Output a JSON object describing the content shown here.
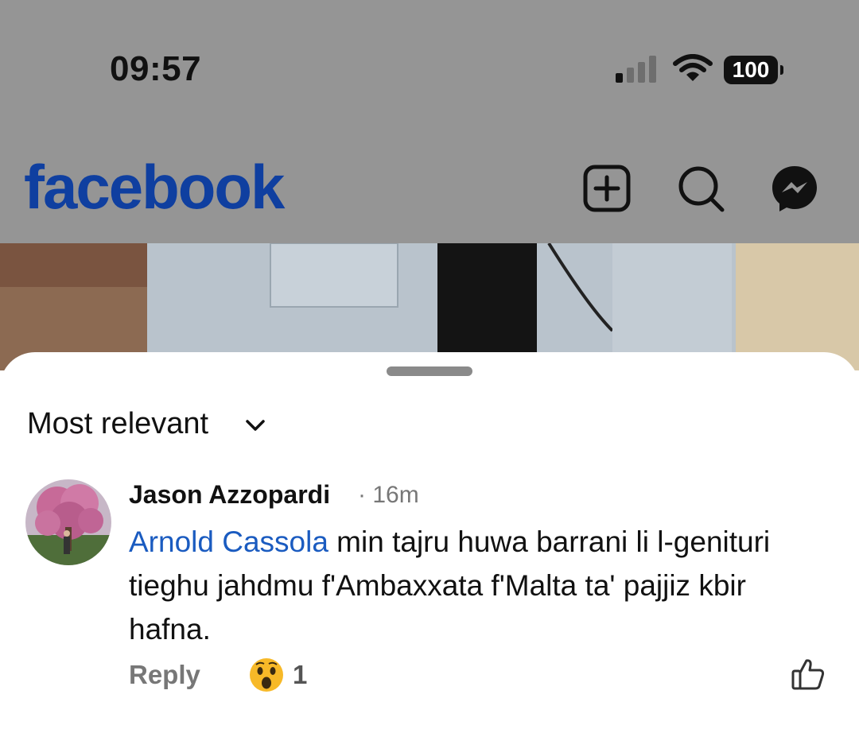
{
  "status_bar": {
    "time": "09:57",
    "battery": "100"
  },
  "header": {
    "brand": "facebook"
  },
  "comments": {
    "sort_label": "Most relevant",
    "items": [
      {
        "author": "Jason Azzopardi",
        "time": "· 16m",
        "mention": "Arnold Cassola",
        "text": " min tajru huwa barrani li l-genituri tieghu jahdmu f'Ambaxxata f'Malta ta' pajjiz kbir hafna.",
        "reply_label": "Reply",
        "reaction_count": "1"
      }
    ]
  },
  "colors": {
    "brand": "#0f3fa0",
    "mention": "#1a5bc0",
    "dim_overlay": "#959595"
  }
}
